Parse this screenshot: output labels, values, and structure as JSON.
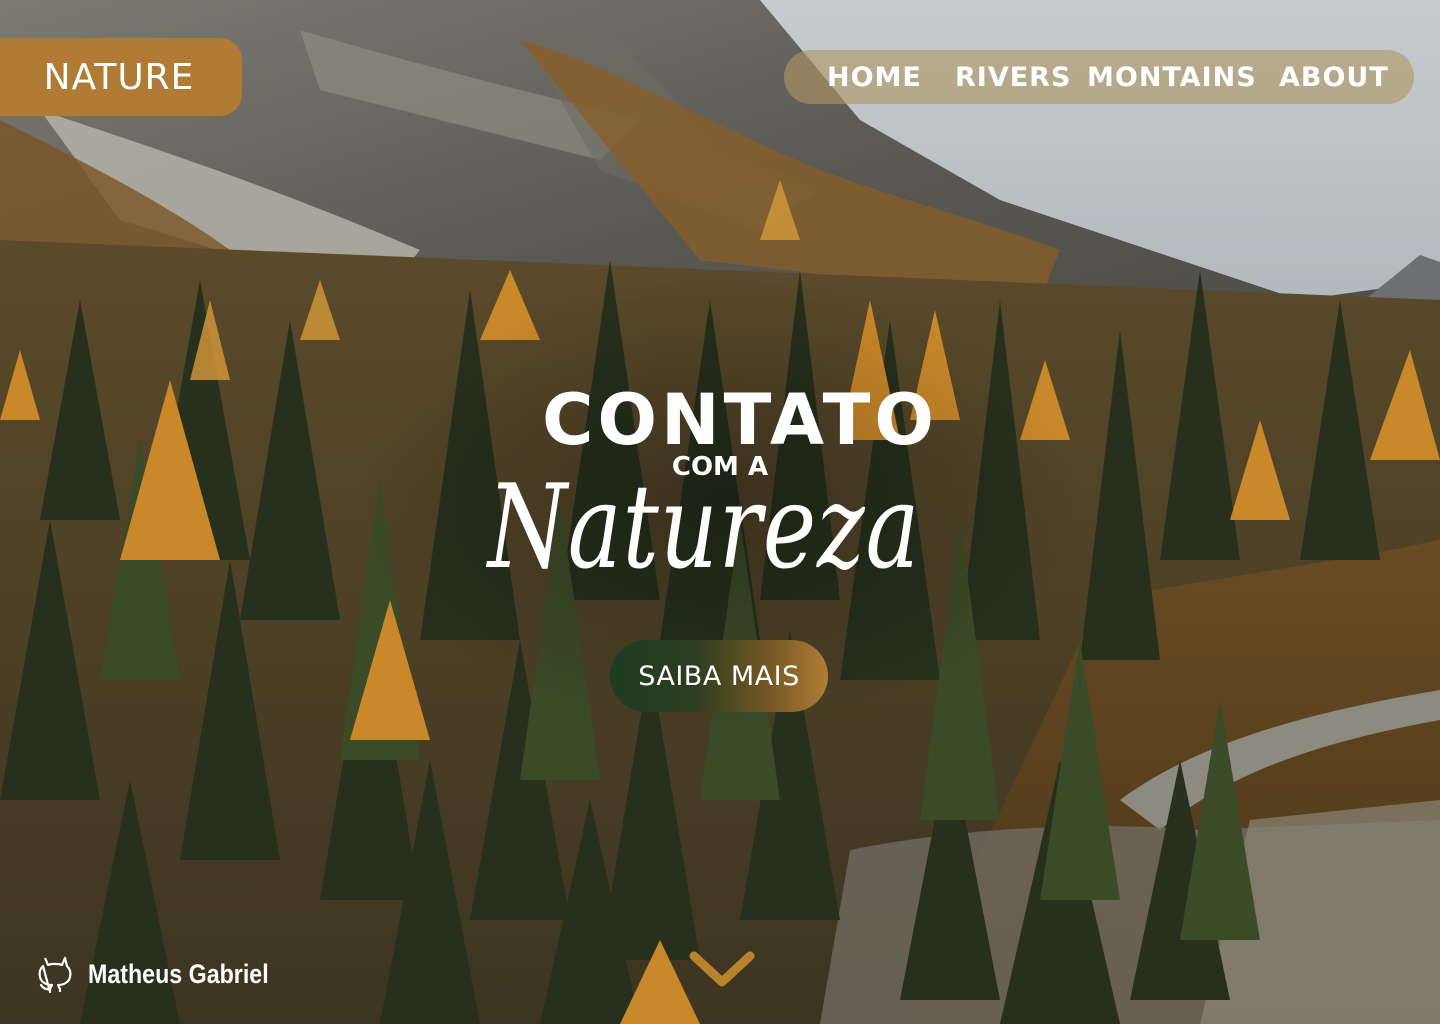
{
  "brand": {
    "logo_text": "NATURE"
  },
  "nav": {
    "items": [
      {
        "label": "HOME"
      },
      {
        "label": "RIVERS"
      },
      {
        "label": "MONTAINS"
      },
      {
        "label": "ABOUT"
      }
    ]
  },
  "hero": {
    "title": "CONTATO",
    "subtitle": "COM A",
    "script": "Natureza",
    "cta_label": "SAIBA MAIS"
  },
  "footer": {
    "author": "Matheus Gabriel",
    "author_icon": "github-icon"
  },
  "scroll_indicator": {
    "icon": "chevron-down-icon"
  },
  "colors": {
    "accent": "#b07c35",
    "nav_background": "#b0966480",
    "cta_gradient_start": "#1e3d20",
    "cta_gradient_end": "#b07e37",
    "text": "#ffffff"
  }
}
